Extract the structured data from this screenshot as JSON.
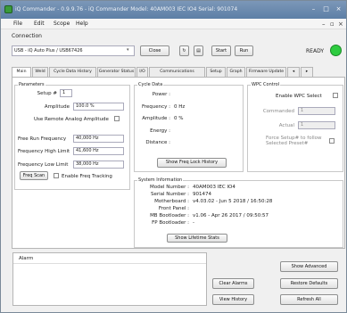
{
  "window": {
    "title": "iQ Commander - 0.9.9.76 - iQ Commander Model: 40AM003 IEC IO4 Serial: 901074"
  },
  "menu": [
    "File",
    "Edit",
    "Scope",
    "Help"
  ],
  "connection": {
    "label": "Connection",
    "device": "USB - iQ Auto Plus / USB67426",
    "close_label": "Close",
    "start_label": "Start",
    "run_label": "Run",
    "status": "READY",
    "status_color": "#2ecc40"
  },
  "tabs": [
    "Main",
    "Weld",
    "Cycle Data History",
    "Generator Status",
    "I/O",
    "Communications",
    "Setup",
    "Graph",
    "Firmware Update"
  ],
  "active_tab": "Main",
  "parameters": {
    "title": "Parameters",
    "setup_label": "Setup #",
    "setup_value": "1",
    "amplitude_label": "Amplitude",
    "amplitude_value": "100.0 %",
    "remote_amp_label": "Use Remote Analog Amplitude",
    "free_run_label": "Free Run Frequency",
    "free_run_value": "40,000 Hz",
    "freq_high_label": "Frequency High Limit",
    "freq_high_value": "41,600 Hz",
    "freq_low_label": "Frequency Low Limit",
    "freq_low_value": "38,000 Hz",
    "freq_scan_label": "Freq Scan",
    "enable_tracking_label": "Enable Freq Tracking"
  },
  "cycle_data": {
    "title": "Cycle Data",
    "power_label": "Power :",
    "frequency_label": "Frequency :",
    "frequency_value": "0 Hz",
    "amplitude_label": "Amplitude :",
    "amplitude_value": "0 %",
    "energy_label": "Energy :",
    "distance_label": "Distance :",
    "show_lock_label": "Show Freq Lock History"
  },
  "wpc": {
    "title": "WPC Control",
    "enable_label": "Enable WPC Select",
    "commanded_label": "Commanded",
    "commanded_value": "1",
    "actual_label": "Actual",
    "actual_value": "1",
    "force_label_1": "Force Setup# to follow",
    "force_label_2": "Selected Preset#"
  },
  "system": {
    "title": "System Information",
    "rows": [
      {
        "label": "Model Number :",
        "value": "40AM003 IEC IO4"
      },
      {
        "label": "Serial Number :",
        "value": "901474"
      },
      {
        "label": "Motherboard :",
        "value": "v4.03.02 - Jun 5 2018 / 16:50:28"
      },
      {
        "label": "Front Panel :",
        "value": ""
      },
      {
        "label": "MB Bootloader :",
        "value": "v1.06 - Apr 26 2017 / 09:50:57"
      },
      {
        "label": "FP Bootloader :",
        "value": "-"
      }
    ],
    "show_lifetime_label": "Show Lifetime Stats"
  },
  "alarm": {
    "title": "Alarm"
  },
  "buttons": {
    "clear_alarms": "Clear Alarms",
    "show_advanced": "Show Advanced",
    "restore_defaults": "Restore Defaults",
    "view_history": "View History",
    "refresh_all": "Refresh All"
  }
}
